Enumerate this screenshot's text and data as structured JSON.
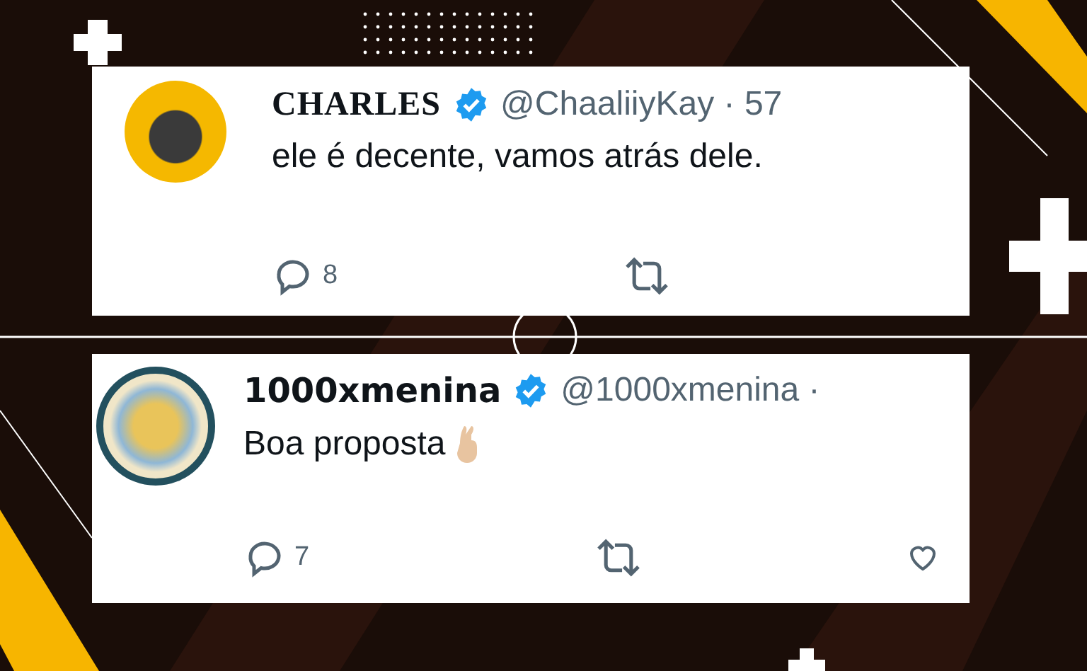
{
  "tweets": [
    {
      "kind": "photo",
      "name": "CHARLES",
      "verified": true,
      "handle": "@ChaaliiyKay",
      "meta": "· 57",
      "text": "ele é decente, vamos atrás dele.",
      "emoji": false,
      "replies": "8",
      "like_visible": false
    },
    {
      "kind": "illustration",
      "name": "1000xmenina",
      "verified": true,
      "handle": "@1000xmenina",
      "meta": "·",
      "text": "Boa proposta",
      "emoji": true,
      "replies": "7",
      "like_visible": true
    }
  ]
}
